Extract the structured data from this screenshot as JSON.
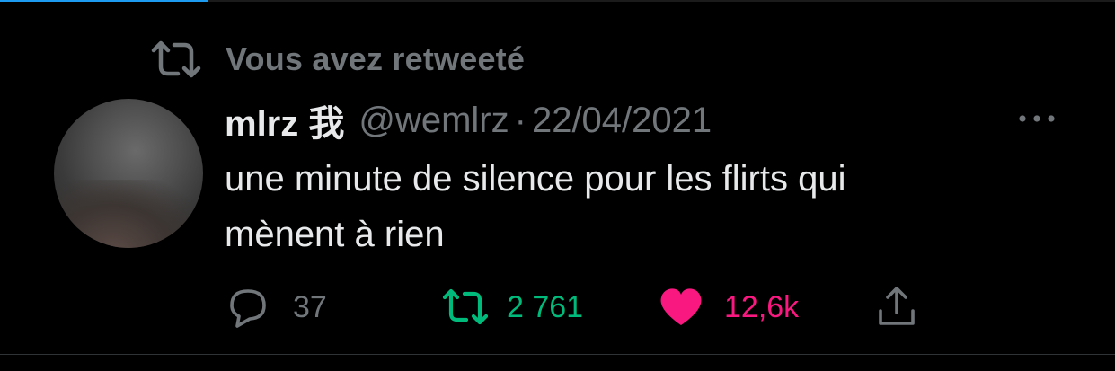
{
  "retweet_context": {
    "label": "Vous avez retweeté"
  },
  "tweet": {
    "display_name": "mlrz 我",
    "handle": "@wemlrz",
    "separator": "·",
    "date": "22/04/2021",
    "text_line_1": "une minute de silence pour les flirts qui",
    "text_line_2": "mènent à rien"
  },
  "actions": {
    "reply_count": "37",
    "retweet_count": "2 761",
    "like_count": "12,6k"
  },
  "icons": {
    "retweet_context": "retweet-icon",
    "more": "more-dots-icon",
    "reply": "reply-bubble-icon",
    "retweet": "retweet-icon",
    "like": "heart-icon",
    "share": "share-icon"
  },
  "colors": {
    "background": "#000000",
    "primary_text": "#e7e9ea",
    "secondary_text": "#71767b",
    "retweet_active": "#00ba7c",
    "like_active": "#f91880"
  }
}
